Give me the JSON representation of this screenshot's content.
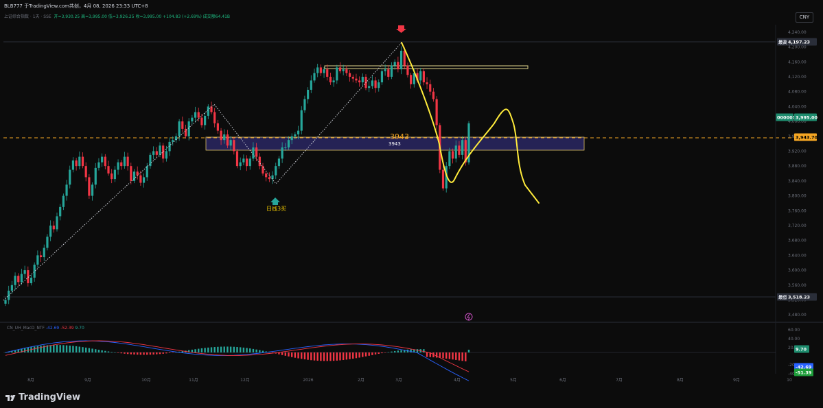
{
  "header": {
    "caption": "BLB777 于TradingView.com共创，4月 08, 2026 23:33 UTC+8",
    "symbol": "上证综合指数 · 1天 · SSE",
    "ohlc": "开=3,930.25  高=3,995.00  低=3,926.25  收=3,995.00  +104.83 (+2.69%)  成交额64.41B",
    "currency": "CNY"
  },
  "chart_data": [
    {
      "type": "candlestick",
      "title": "上证综合指数",
      "y_axis_ticks": [
        "4,240.00",
        "4,200.00",
        "4,160.00",
        "4,120.00",
        "4,080.00",
        "4,040.00",
        "4,000.00",
        "3,960.00",
        "3,920.00",
        "3,880.00",
        "3,840.00",
        "3,800.00",
        "3,760.00",
        "3,720.00",
        "3,680.00",
        "3,640.00",
        "3,600.00",
        "3,560.00",
        "3,520.00",
        "3,480.00"
      ],
      "x_axis_ticks": [
        "8月",
        "9月",
        "10月",
        "11月",
        "12月",
        "2026",
        "2月",
        "3月",
        "4月",
        "5月",
        "6月",
        "7月",
        "8月",
        "9月",
        "10"
      ],
      "ylim": [
        3460,
        4260
      ],
      "closes": [
        3520,
        3545,
        3560,
        3585,
        3568,
        3590,
        3600,
        3565,
        3580,
        3615,
        3640,
        3635,
        3660,
        3690,
        3720,
        3710,
        3745,
        3770,
        3800,
        3830,
        3870,
        3895,
        3880,
        3905,
        3880,
        3850,
        3800,
        3830,
        3875,
        3890,
        3905,
        3880,
        3860,
        3845,
        3870,
        3890,
        3880,
        3905,
        3880,
        3840,
        3865,
        3855,
        3835,
        3850,
        3880,
        3910,
        3920,
        3910,
        3935,
        3900,
        3920,
        3945,
        3950,
        3960,
        4000,
        3980,
        3960,
        4000,
        4010,
        4025,
        4010,
        3990,
        4015,
        4040,
        4025,
        3995,
        3975,
        3950,
        3965,
        3935,
        3950,
        3920,
        3880,
        3890,
        3900,
        3880,
        3900,
        3930,
        3905,
        3880,
        3860,
        3850,
        3845,
        3855,
        3880,
        3900,
        3930,
        3930,
        3950,
        3960,
        3965,
        3975,
        4030,
        4060,
        4085,
        4110,
        4130,
        4145,
        4130,
        4140,
        4120,
        4105,
        4110,
        4145,
        4135,
        4140,
        4130,
        4120,
        4115,
        4110,
        4105,
        4120,
        4090,
        4095,
        4110,
        4090,
        4105,
        4135,
        4140,
        4120,
        4150,
        4160,
        4140,
        4190,
        4150,
        4125,
        4100,
        4130,
        4110,
        4135,
        4105,
        4100,
        4080,
        4060,
        3990,
        3870,
        3820,
        3880,
        3920,
        3900,
        3935,
        3910,
        3950,
        3890,
        3995
      ],
      "annotations": {
        "high_label": "最高价",
        "high_value": "4,197.23",
        "low_label": "最低价",
        "low_value": "3,518.23",
        "price_tag_name": "000001",
        "price_tag_value": "3,995.00",
        "dashed_level_value": "3,943.70",
        "level_label_orange": "3943",
        "level_label_white": "3943",
        "buy_signal_text": "日线3买"
      }
    },
    {
      "type": "macd",
      "title": "CN_UH_MacD_NTF",
      "values": [
        "-42.69",
        "-52.39",
        "9.70"
      ],
      "y_axis_ticks": [
        "60.00",
        "40.00",
        "20.00",
        "-20.00",
        "-40.00"
      ],
      "current_hist": "9.70",
      "current_macd": "-42.69",
      "current_signal": "-51.39"
    }
  ],
  "footer": {
    "brand": "TradingView"
  },
  "colors": {
    "up": "#26a69a",
    "down": "#f23645",
    "orange": "#f5a623",
    "yellow": "#ffeb3b",
    "box": "#2d2a6e"
  }
}
